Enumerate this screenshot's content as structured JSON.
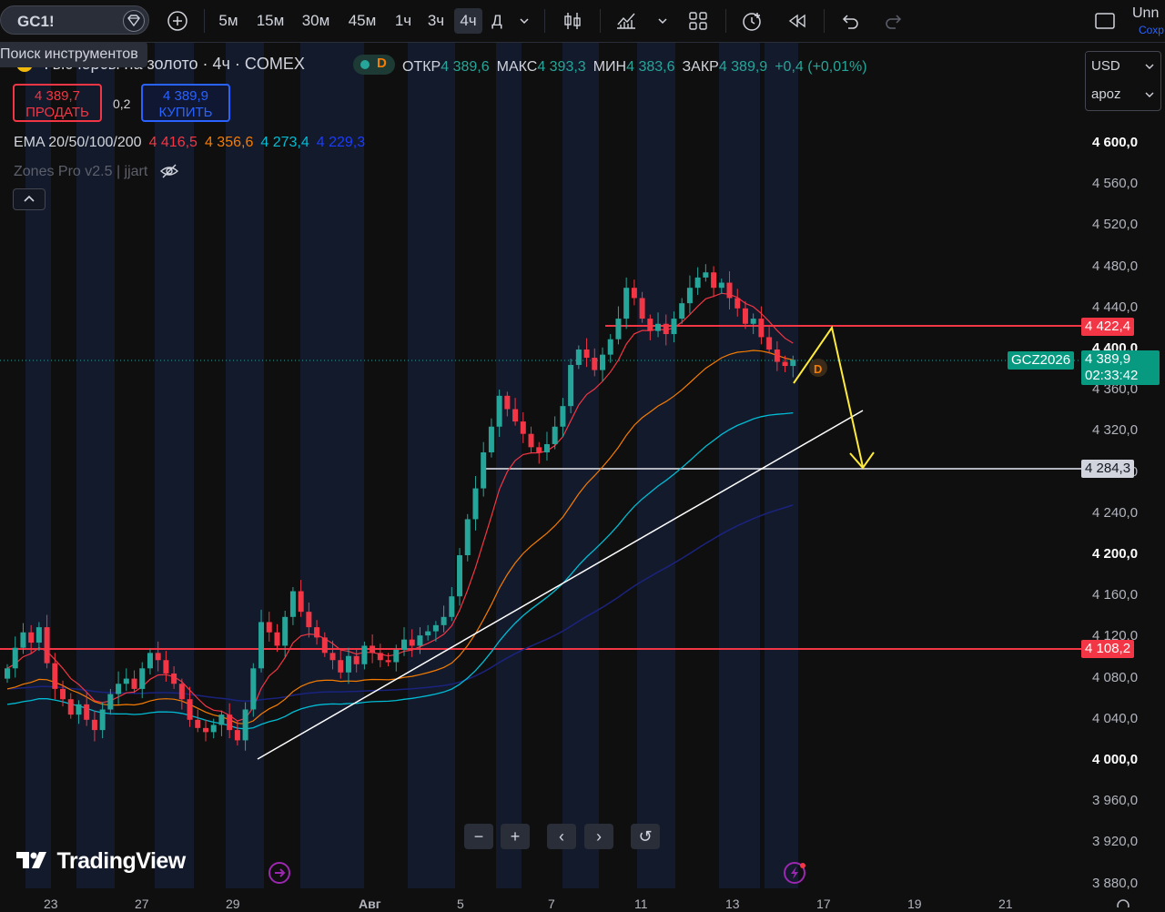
{
  "toolbar": {
    "symbol": "GC1!",
    "timeframes": [
      "5м",
      "15м",
      "30м",
      "45м",
      "1ч",
      "3ч",
      "4ч",
      "Д"
    ],
    "active_timeframe": "4ч",
    "account_label": "Unn",
    "account_sub": "Сохр"
  },
  "tooltip": "Поиск инструментов",
  "legend": {
    "title": "Фьючерсы на золото · 4ч · COMEX",
    "d_badge": "D",
    "open_label": "ОТКР",
    "open": "4 389,6",
    "high_label": "МАКС",
    "high": "4 393,3",
    "low_label": "МИН",
    "low": "4 383,6",
    "close_label": "ЗАКР",
    "close": "4 389,9",
    "change": "+0,4 (+0,01%)"
  },
  "trade": {
    "sell_price": "4 389,7",
    "sell_label": "ПРОДАТЬ",
    "spread": "0,2",
    "buy_price": "4 389,9",
    "buy_label": "КУПИТЬ"
  },
  "indicators": {
    "ema_label": "EMA 20/50/100/200",
    "ema_values": [
      "4 416,5",
      "4 356,6",
      "4 273,4",
      "4 229,3"
    ],
    "ema_colors": [
      "#f23645",
      "#f57c00",
      "#00bcd4",
      "#1a237e"
    ],
    "zones_label": "Zones Pro v2.5 | jjart"
  },
  "scale_controls": {
    "currency": "USD",
    "mode": "apoz"
  },
  "price_axis": [
    "4 600,0",
    "4 560,0",
    "4 520,0",
    "4 480,0",
    "4 440,0",
    "4 400,0",
    "4 360,0",
    "4 320,0",
    "4 280,0",
    "4 240,0",
    "4 200,0",
    "4 160,0",
    "4 120,0",
    "4 080,0",
    "4 040,0",
    "4 000,0",
    "3 960,0",
    "3 920,0",
    "3 880,0"
  ],
  "bold_prices": [
    "4 600,0",
    "4 400,0",
    "4 200,0",
    "4 000,0"
  ],
  "time_axis": [
    "23",
    "27",
    "29",
    "Авг",
    "5",
    "7",
    "11",
    "13",
    "17",
    "19",
    "21"
  ],
  "price_tags": {
    "resistance": "4 422,4",
    "current": "4 389,9",
    "countdown": "02:33:42",
    "contract": "GCZ2026",
    "target": "4 284,3",
    "support": "4 108,2"
  },
  "colors": {
    "up": "#26a69a",
    "down": "#f23645",
    "accent": "#2962ff",
    "forecast": "#ffeb3b"
  },
  "watermark": "TradingView",
  "nav_buttons": [
    "−",
    "+",
    "‹",
    "›",
    "↺"
  ]
}
